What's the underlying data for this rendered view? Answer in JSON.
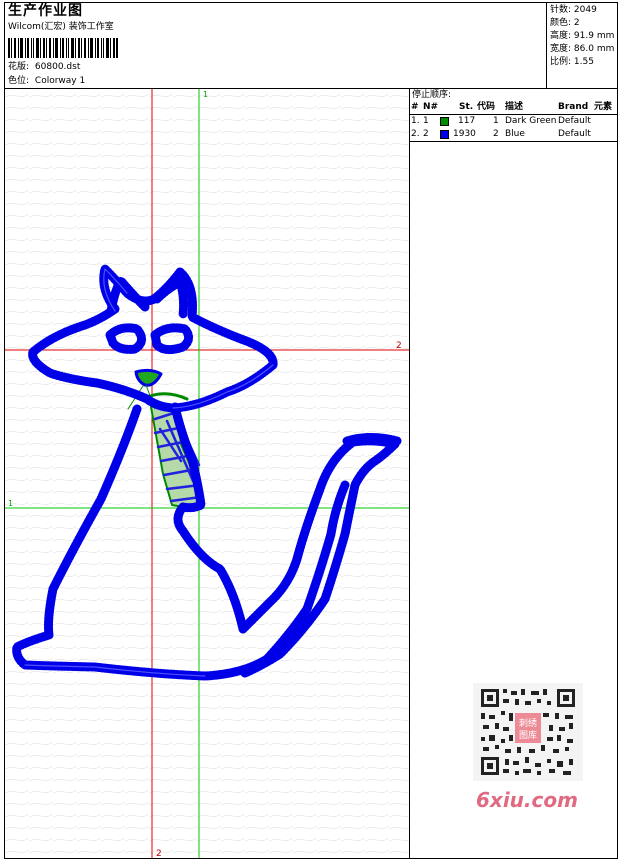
{
  "header": {
    "title": "生产作业图",
    "subtitle": "Wilcom(汇宏) 装饰工作室",
    "file_label": "花版:",
    "file_name": "60800.dst",
    "color_label": "色位:",
    "colorway": "Colorway 1"
  },
  "stats": [
    {
      "label": "针数:",
      "value": "2049"
    },
    {
      "label": "颜色:",
      "value": "2"
    },
    {
      "label": "高度:",
      "value": "91.9 mm"
    },
    {
      "label": "宽度:",
      "value": "86.0 mm"
    },
    {
      "label": "比例:",
      "value": "1.55"
    }
  ],
  "canvas": {
    "guide_labels": {
      "red_horizontal": "2",
      "red_vertical_top": "1",
      "green_horizontal": "1",
      "red_vertical_bottom": "2"
    },
    "colors": {
      "red": "#e00000",
      "green": "#00c800",
      "blue": "#0000e8",
      "dark_green": "#008a00"
    }
  },
  "stop_sequence": {
    "title": "停止顺序:",
    "columns": [
      "#",
      "N#",
      "St.",
      "代码",
      "描述",
      "Brand",
      "元素"
    ],
    "rows": [
      {
        "num": "1.",
        "n": "1",
        "color": "#008a00",
        "stitches": "117",
        "code": "1",
        "description": "Dark Green",
        "brand": "Default"
      },
      {
        "num": "2.",
        "n": "2",
        "color": "#0000e8",
        "stitches": "1930",
        "code": "2",
        "description": "Blue",
        "brand": "Default"
      }
    ]
  },
  "watermark": {
    "site": "6xiu.com",
    "qr_center_text": "刺绣图库"
  }
}
